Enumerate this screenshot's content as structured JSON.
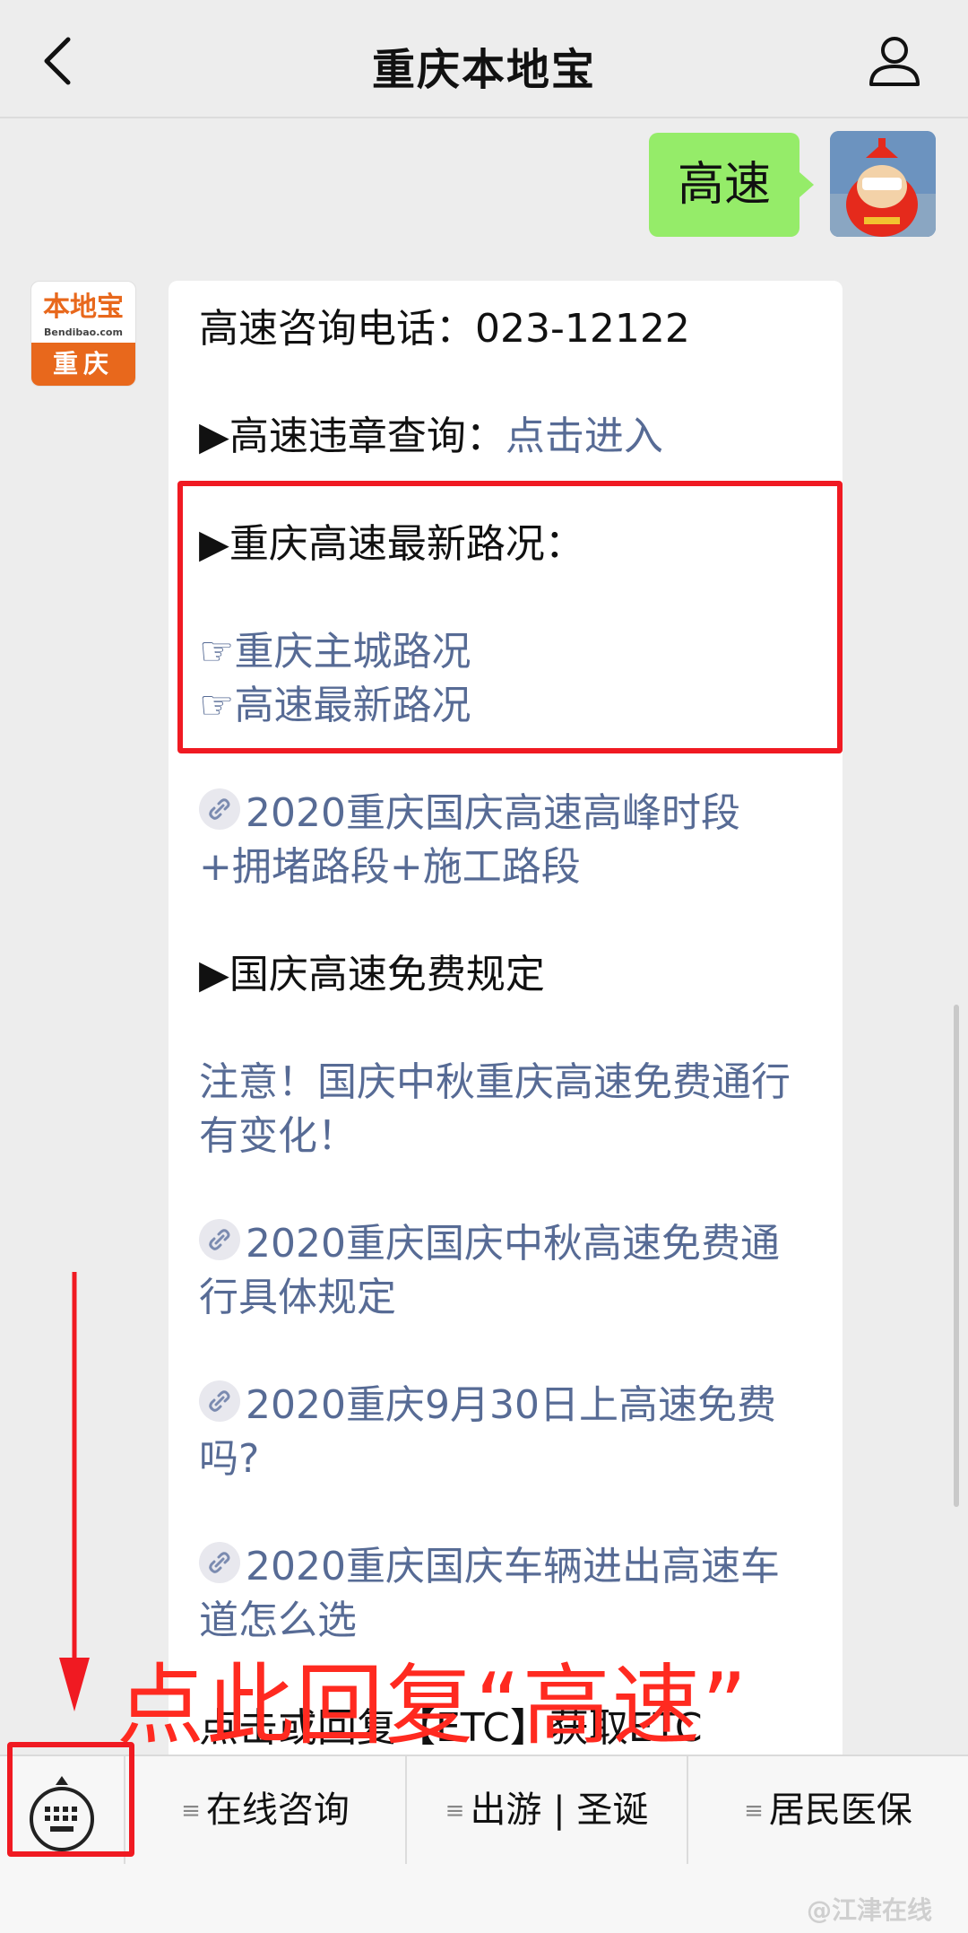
{
  "header": {
    "title": "重庆本地宝"
  },
  "outgoing_message": {
    "text": "高速"
  },
  "account_avatar": {
    "brand": "本地宝",
    "domain": "Bendibao.com",
    "city": "重庆"
  },
  "reply": {
    "phone_line": "高速咨询电话：023-12122",
    "violation_label": "▶高速违章查询：",
    "violation_link": "点击进入",
    "latest_heading": "▶重庆高速最新路况：",
    "road_link_1": "☞重庆主城路况",
    "road_link_2": "☞高速最新路况",
    "article_1": "2020重庆国庆高速高峰时段+拥堵路段+施工路段",
    "free_heading": "▶国庆高速免费规定",
    "notice_link": "注意！国庆中秋重庆高速免费通行有变化！",
    "article_2": "2020重庆国庆中秋高速免费通行具体规定",
    "article_3": "2020重庆9月30日上高速免费吗?",
    "article_4": "2020重庆国庆车辆进出高速车道怎么选",
    "etc_line": "点击或回复【ETC】获取ETC"
  },
  "annotation": {
    "text": "点此回复“高速”"
  },
  "menu": {
    "items": [
      {
        "label": "在线咨询"
      },
      {
        "label": "出游 | 圣诞"
      },
      {
        "label": "居民医保"
      }
    ]
  },
  "watermark": {
    "text": "@江津在线"
  },
  "colors": {
    "link": "#576b95",
    "outgoing_bubble": "#95ec69",
    "highlight_red": "#f01a22",
    "brand_orange": "#e8681c"
  },
  "icons": [
    "back-chevron-icon",
    "user-profile-icon",
    "mini-program-icon",
    "keyboard-icon",
    "menu-lines-icon"
  ]
}
